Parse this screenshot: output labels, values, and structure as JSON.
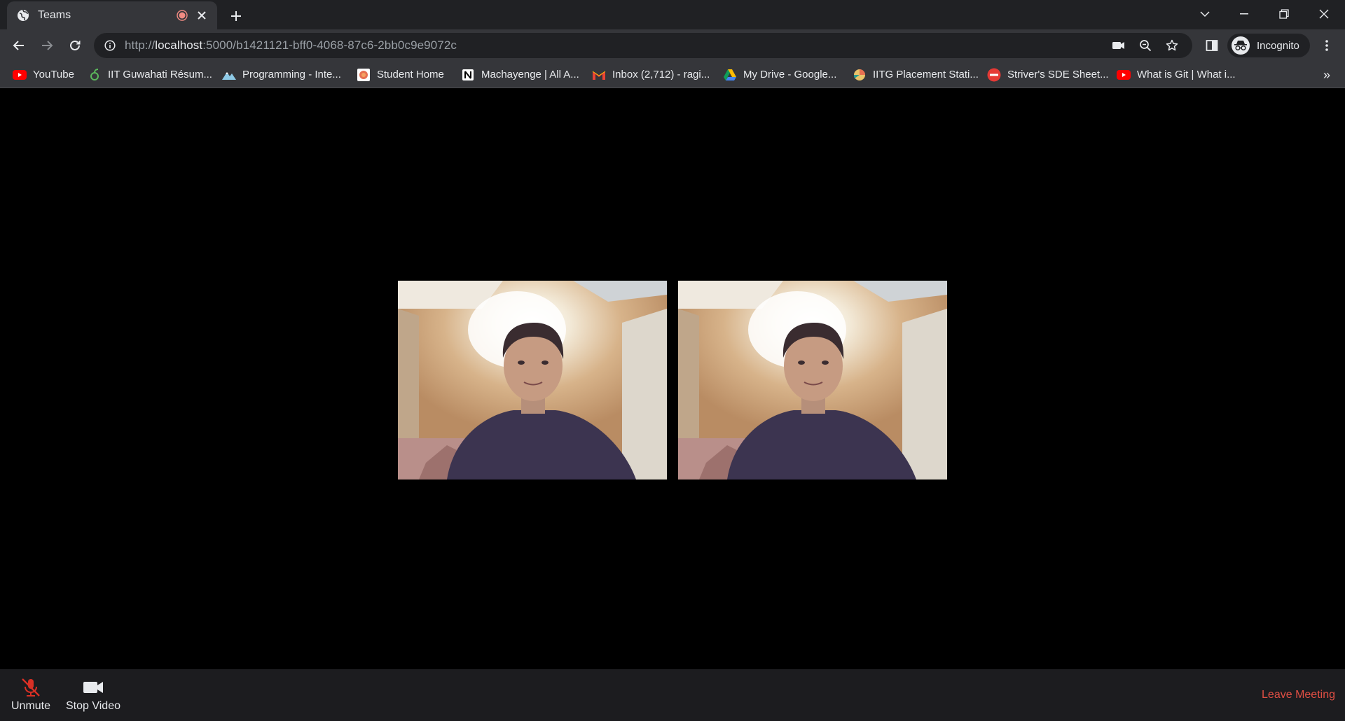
{
  "browser": {
    "tab": {
      "title": "Teams"
    },
    "address": {
      "scheme": "http://",
      "host": "localhost",
      "rest": ":5000/b1421121-bff0-4068-87c6-2bb0c9e9072c"
    },
    "profile": {
      "label": "Incognito"
    },
    "bookmarks": [
      {
        "label": "YouTube",
        "icon": "youtube-icon"
      },
      {
        "label": "IIT Guwahati Résum...",
        "icon": "resume-icon"
      },
      {
        "label": "Programming - Inte...",
        "icon": "mountain-icon"
      },
      {
        "label": "Student Home",
        "icon": "student-home-icon"
      },
      {
        "label": "Machayenge | All A...",
        "icon": "notion-icon"
      },
      {
        "label": "Inbox (2,712) - ragi...",
        "icon": "gmail-icon"
      },
      {
        "label": "My Drive - Google...",
        "icon": "google-drive-icon"
      },
      {
        "label": "IITG Placement Stati...",
        "icon": "placement-icon"
      },
      {
        "label": "Striver's SDE Sheet...",
        "icon": "tuf-icon"
      },
      {
        "label": "What is Git | What i...",
        "icon": "youtube-icon"
      }
    ]
  },
  "meeting": {
    "controls": {
      "unmute_label": "Unmute",
      "stop_video_label": "Stop Video",
      "leave_label": "Leave Meeting"
    },
    "colors": {
      "leave": "#e04f44",
      "muted_icon": "#d93025"
    }
  }
}
